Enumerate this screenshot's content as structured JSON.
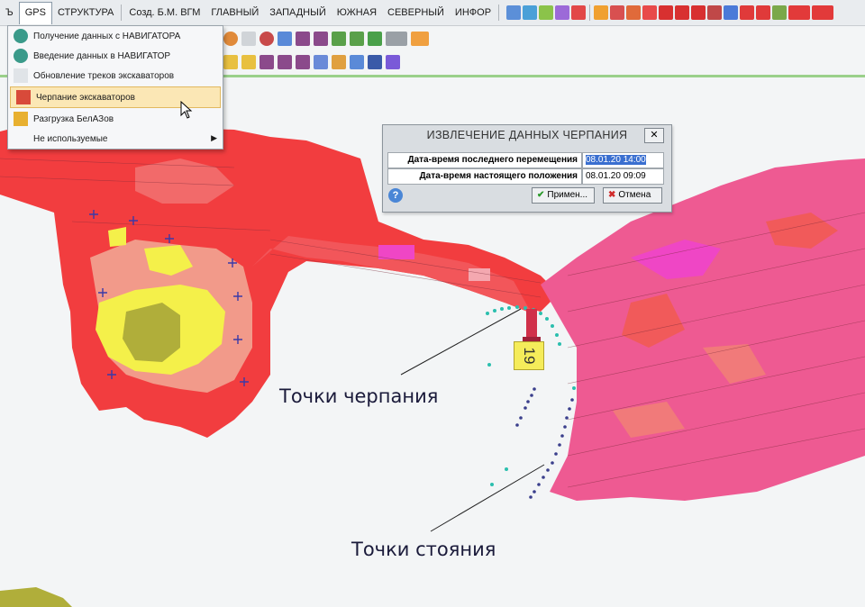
{
  "menubar": {
    "items": [
      "Ъ",
      "GPS",
      "СТРУКТУРА",
      "Созд. Б.М. ВГМ",
      "ГЛАВНЫЙ",
      "ЗАПАДНЫЙ",
      "ЮЖНАЯ",
      "СЕВЕРНЫЙ",
      "ИНФОР"
    ]
  },
  "dropdown": {
    "items": [
      {
        "label": "Получение данных с НАВИГАТОРА",
        "icon": "globe-icon"
      },
      {
        "label": "Введение данных в НАВИГАТОР",
        "icon": "globe-icon"
      },
      {
        "label": "Обновление треков экскаваторов",
        "icon": "refresh-icon"
      },
      {
        "label": "Черпание экскаваторов",
        "icon": "excavator-icon",
        "highlighted": true
      },
      {
        "label": "Разгрузка БелАЗов",
        "icon": "truck-icon"
      },
      {
        "label": "Не используемые",
        "icon": "",
        "submenu": true
      }
    ]
  },
  "dialog": {
    "title": "ИЗВЛЕЧЕНИЕ ДАННЫХ ЧЕРПАНИЯ",
    "close": "✕",
    "row1_label": "Дата-время последнего перемещения",
    "row1_value": "08.01.20 14:00",
    "row2_label": "Дата-время настоящего положения",
    "row2_value": "08.01.20 09:09",
    "help": "?",
    "apply": "Примен...",
    "cancel": "Отмена"
  },
  "map": {
    "badge": "19",
    "callout_scoop": "Точки черпания",
    "callout_standing": "Точки стояния"
  },
  "colors": {
    "red": "#f23d3f",
    "salmon": "#f29a8a",
    "pink": "#ee5a92",
    "magenta": "#ef46c5",
    "yellow": "#f4f04a",
    "olive": "#b0ae3a",
    "teal": "#2bbfae",
    "navy": "#3a3f8c",
    "menu_highlight": "#fbe7b5"
  }
}
